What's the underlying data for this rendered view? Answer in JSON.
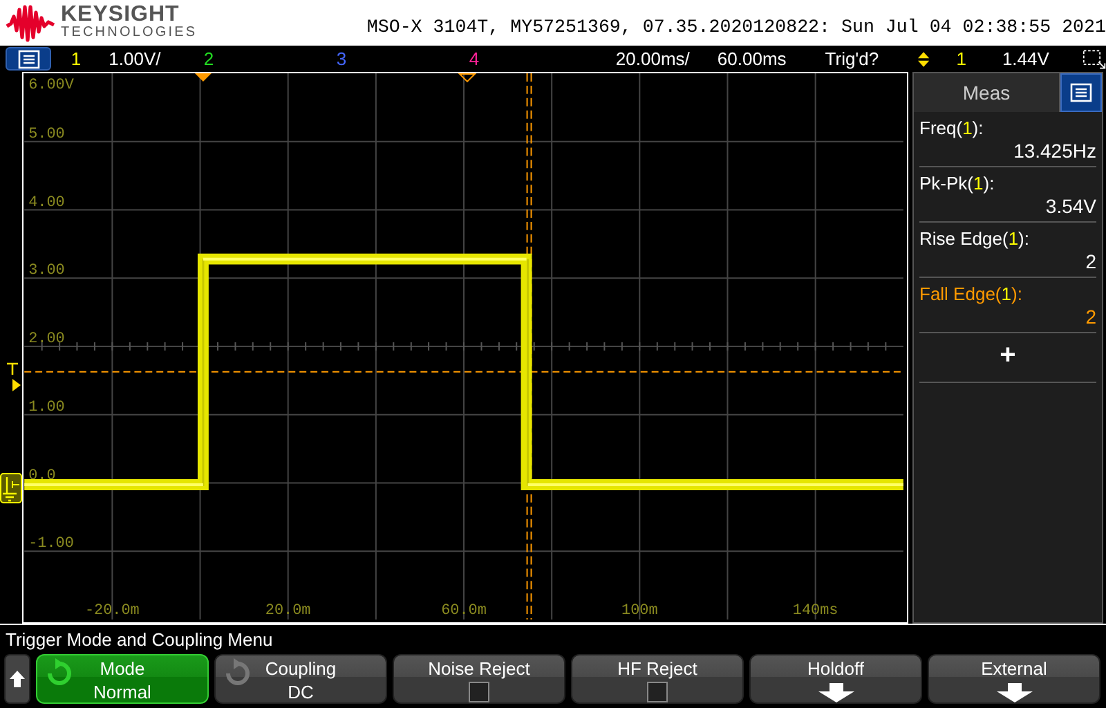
{
  "header": {
    "brand": "KEYSIGHT",
    "brand_sub": "TECHNOLOGIES",
    "instrument": "MSO-X 3104T, MY57251369, 07.35.2020120822: Sun Jul 04 02:38:55 2021"
  },
  "status_bar": {
    "channels": [
      {
        "label": "1",
        "color": "#ffff00",
        "scale": "1.00V/"
      },
      {
        "label": "2",
        "color": "#22dd22"
      },
      {
        "label": "3",
        "color": "#4466ff"
      },
      {
        "label": "4",
        "color": "#ff2299"
      }
    ],
    "timebase": "20.00ms/",
    "delay": "60.00ms",
    "trigger_status": "Trig'd?",
    "trigger_source": "1",
    "trigger_level": "1.44V"
  },
  "graticule": {
    "y_labels": [
      "6.00V",
      "5.00",
      "4.00",
      "3.00",
      "2.00",
      "1.00",
      "0.0",
      "-1.00"
    ],
    "x_labels": [
      "-20.0m",
      "20.0m",
      "60.0m",
      "100m",
      "140ms"
    ]
  },
  "meas_panel": {
    "title": "Meas",
    "items": [
      {
        "label": "Freq(",
        "channel": "1",
        "suffix": "):",
        "value": "13.425Hz",
        "selected": false
      },
      {
        "label": "Pk-Pk(",
        "channel": "1",
        "suffix": "):",
        "value": "3.54V",
        "selected": false
      },
      {
        "label": "Rise Edge(",
        "channel": "1",
        "suffix": "):",
        "value": "2",
        "selected": false
      },
      {
        "label": "Fall Edge(",
        "channel": "1",
        "suffix": "):",
        "value": "2",
        "selected": true
      }
    ],
    "add_button": "+"
  },
  "menu": {
    "title": "Trigger Mode and Coupling Menu",
    "softkeys": [
      {
        "kind": "cycle",
        "label": "Mode",
        "value": "Normal",
        "selected": true
      },
      {
        "kind": "cycle",
        "label": "Coupling",
        "value": "DC",
        "selected": false
      },
      {
        "kind": "checkbox",
        "label": "Noise Reject",
        "checked": false
      },
      {
        "kind": "checkbox",
        "label": "HF Reject",
        "checked": false
      },
      {
        "kind": "submenu",
        "label": "Holdoff"
      },
      {
        "kind": "submenu",
        "label": "External"
      }
    ]
  }
}
